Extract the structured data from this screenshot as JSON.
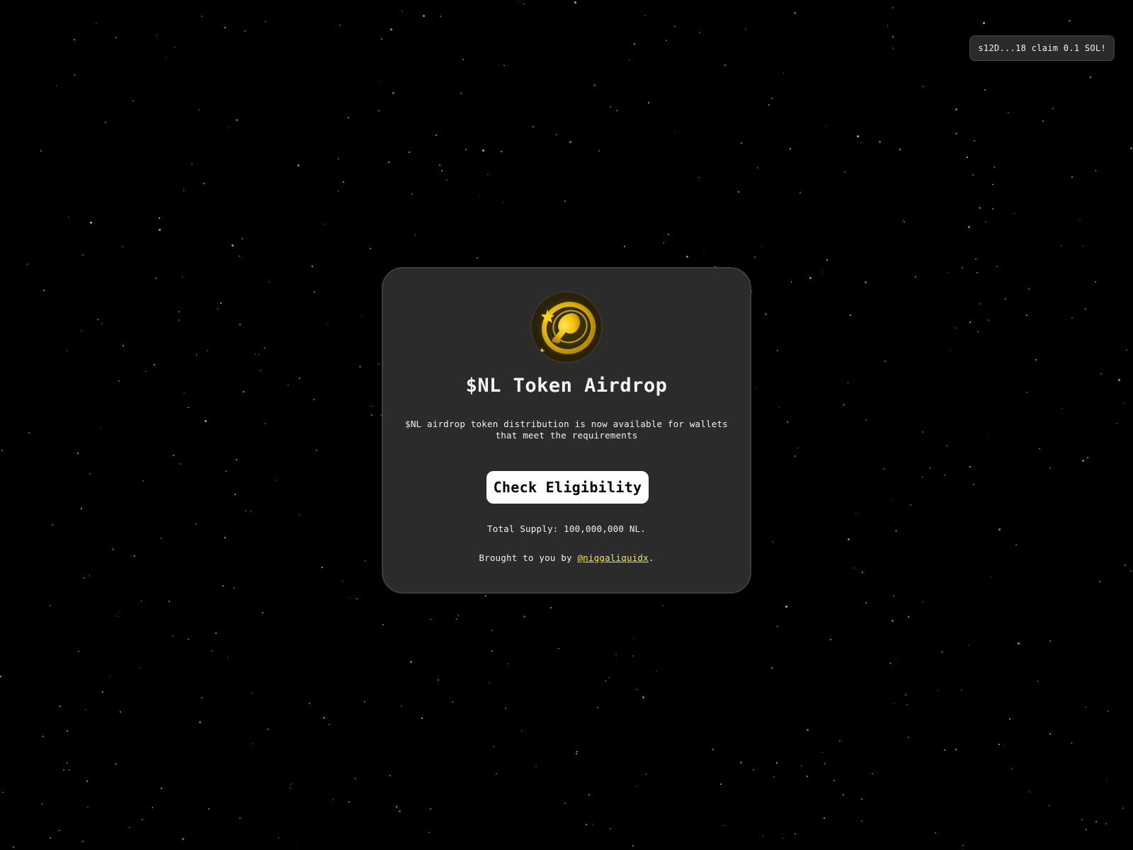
{
  "toast": {
    "message": "s12D...18 claim 0.1 SOL!"
  },
  "card": {
    "logo_icon": "golden-coin-drumstick-icon",
    "title": "$NL Token Airdrop",
    "description": "$NL airdrop token distribution is now available for wallets that meet the requirements",
    "check_button_label": "Check Eligibility",
    "supply_text": "Total Supply: 100,000,000 NL.",
    "credit_prefix": "Brought to you by ",
    "credit_handle": "@niggaliquidx",
    "credit_suffix": "."
  },
  "colors": {
    "background": "#000000",
    "card": "#2b2b2b",
    "accent_link": "#f5e34a",
    "coin_gold": "#f2c200"
  }
}
